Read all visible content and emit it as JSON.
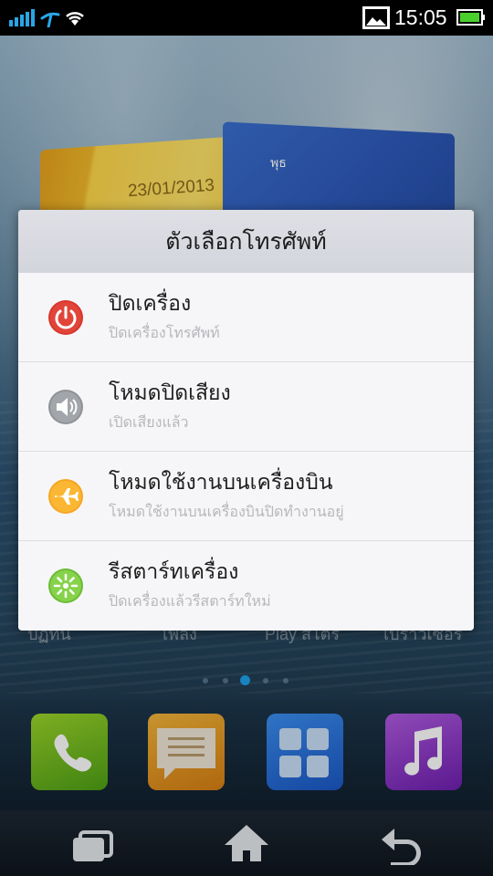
{
  "status_bar": {
    "time": "15:05",
    "icons": [
      "signal-icon",
      "carrier-icon",
      "wifi-icon",
      "gallery-icon",
      "battery-icon"
    ]
  },
  "home": {
    "calendar_date": "23/01/2013",
    "calendar_day": "พุธ",
    "background_labels": [
      "ปฏิทิน",
      "เพลง",
      "Play สโตร์",
      "เบราว์เซอร์"
    ],
    "page_indicator": {
      "count": 5,
      "active": 3
    },
    "dock_apps": [
      "phone-icon",
      "messages-icon",
      "apps-icon",
      "music-icon"
    ]
  },
  "dialog": {
    "title": "ตัวเลือกโทรศัพท์",
    "options": [
      {
        "title": "ปิดเครื่อง",
        "subtitle": "ปิดเครื่องโทรศัพท์",
        "icon": "power-icon",
        "color": "#d9352b"
      },
      {
        "title": "โหมดปิดเสียง",
        "subtitle": "เปิดเสียงแล้ว",
        "icon": "speaker-icon",
        "color": "#8e9296"
      },
      {
        "title": "โหมดใช้งานบนเครื่องบิน",
        "subtitle": "โหมดใช้งานบนเครื่องบินปิดทำงานอยู่",
        "icon": "airplane-icon",
        "color": "#f5a623"
      },
      {
        "title": "รีสตาร์ทเครื่อง",
        "subtitle": "ปิดเครื่องแล้วรีสตาร์ทใหม่",
        "icon": "restart-icon",
        "color": "#7ac943"
      }
    ]
  },
  "nav": {
    "buttons": [
      "recent-apps-icon",
      "home-icon",
      "back-icon"
    ]
  },
  "colors": {
    "accent": "#1ea0e8",
    "dialog_bg": "#f4f4f6",
    "title_bg": "#d8d9df"
  }
}
